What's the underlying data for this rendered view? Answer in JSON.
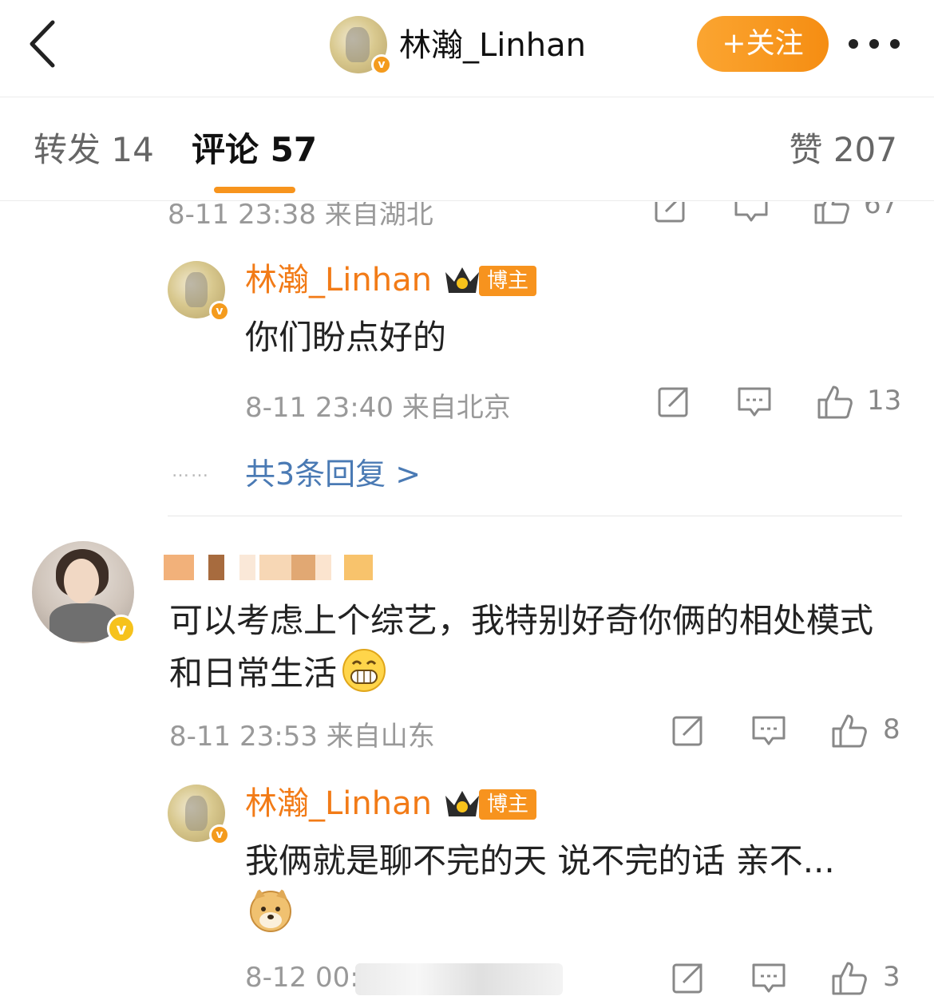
{
  "header": {
    "back_label": "‹",
    "name": "林瀚_Linhan",
    "follow_label": "+关注",
    "accent": "#F7941D"
  },
  "tabs": {
    "repost": "转发 14",
    "comment": "评论 57",
    "like": "赞 207"
  },
  "top_partial": {
    "meta": "8-11 23:38  来自湖北",
    "like_count": "67"
  },
  "comments": [
    {
      "name": "林瀚_Linhan",
      "badge": "博主",
      "text": "你们盼点好的",
      "meta": "8-11 23:40  来自北京",
      "like_count": "13",
      "more_replies": "共3条回复 >"
    },
    {
      "text": "可以考虑上个综艺，我特别好奇你俩的相处模式和日常生活",
      "meta": "8-11 23:53  来自山东",
      "like_count": "8"
    },
    {
      "name": "林瀚_Linhan",
      "badge": "博主",
      "text": "我俩就是聊不完的天 说不完的话 亲不...",
      "meta": "8-12 00:",
      "like_count": "3"
    }
  ],
  "icons": [
    "back-icon",
    "more-icon",
    "verified-badge-icon",
    "crown-icon",
    "share-icon",
    "comment-icon",
    "like-icon",
    "grin-emoji-icon",
    "doge-emoji-icon"
  ]
}
